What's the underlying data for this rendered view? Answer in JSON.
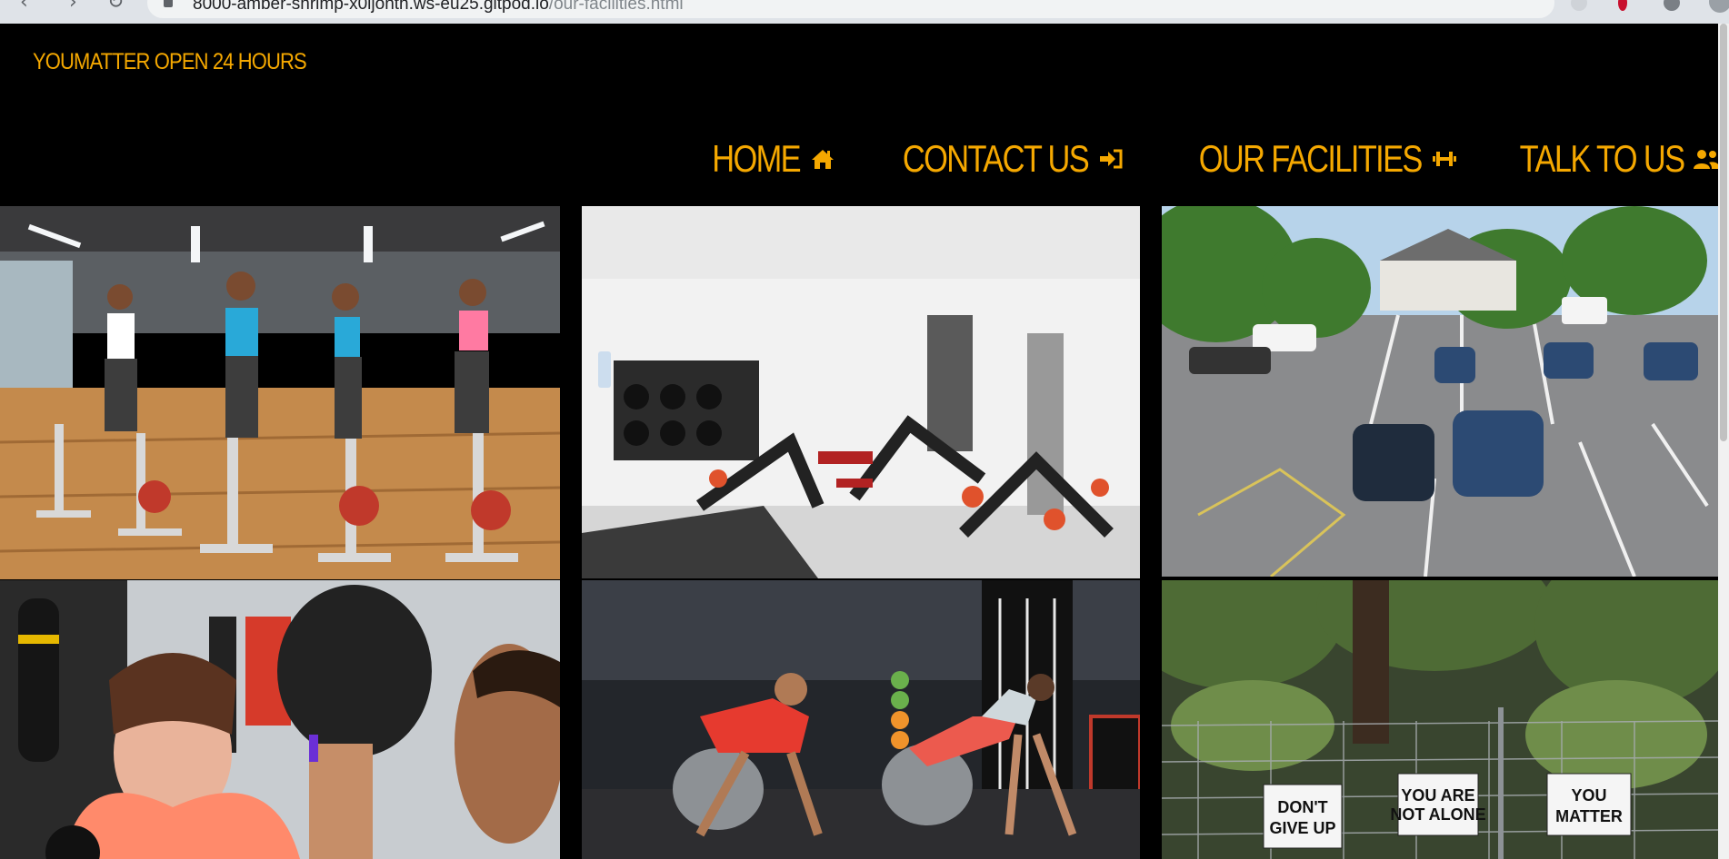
{
  "browser": {
    "url_host": "8000-amber-shrimp-x0ljonth.ws-eu25.gitpod.io",
    "url_path": "/our-facilities.html"
  },
  "header": {
    "brand": "YOUMATTER OPEN 24 HOURS",
    "accent_color": "#f5a800"
  },
  "nav": {
    "items": [
      {
        "label": "HOME",
        "icon": "home-icon"
      },
      {
        "label": "CONTACT US",
        "icon": "sign-in-icon"
      },
      {
        "label": "OUR FACILITIES",
        "icon": "dumbbell-icon"
      },
      {
        "label": "TALK TO US",
        "icon": "users-icon"
      }
    ]
  },
  "gallery": {
    "images": [
      {
        "name": "spin-class-photo"
      },
      {
        "name": "gym-equipment-photo"
      },
      {
        "name": "car-park-photo"
      },
      {
        "name": "boxing-training-photo"
      },
      {
        "name": "stability-ball-workout-photo"
      },
      {
        "name": "motivational-signs-photo"
      }
    ],
    "signs": [
      "DON'T GIVE UP",
      "YOU ARE NOT ALONE",
      "YOU MATTER"
    ]
  }
}
